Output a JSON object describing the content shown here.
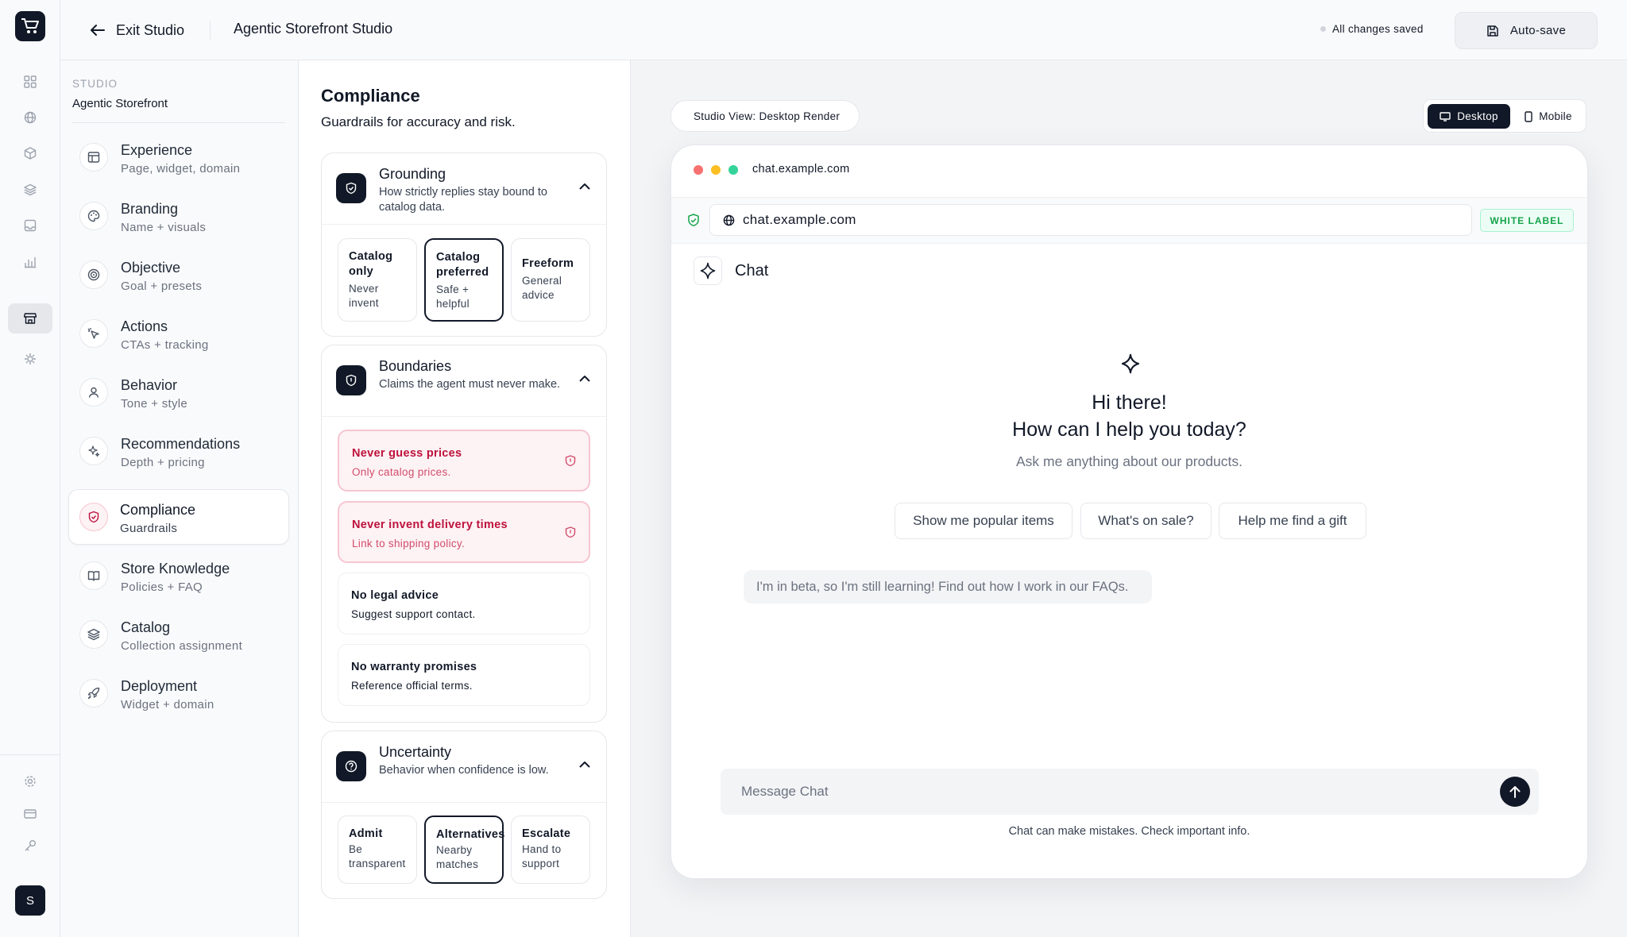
{
  "topbar": {
    "exit_label": "Exit Studio",
    "title": "Agentic Storefront Studio",
    "status": "All changes saved",
    "autosave_label": "Auto-save"
  },
  "rail": {
    "user_initial": "S"
  },
  "sidebar": {
    "section_label": "STUDIO",
    "section_title": "Agentic Storefront",
    "items": [
      {
        "title": "Experience",
        "sub": "Page, widget, domain",
        "icon": "layout-icon"
      },
      {
        "title": "Branding",
        "sub": "Name + visuals",
        "icon": "palette-icon"
      },
      {
        "title": "Objective",
        "sub": "Goal + presets",
        "icon": "target-icon"
      },
      {
        "title": "Actions",
        "sub": "CTAs + tracking",
        "icon": "pointer-icon"
      },
      {
        "title": "Behavior",
        "sub": "Tone + style",
        "icon": "user-icon"
      },
      {
        "title": "Recommendations",
        "sub": "Depth + pricing",
        "icon": "sparkles-icon"
      },
      {
        "title": "Compliance",
        "sub": "Guardrails",
        "icon": "shield-icon"
      },
      {
        "title": "Store Knowledge",
        "sub": "Policies + FAQ",
        "icon": "book-icon"
      },
      {
        "title": "Catalog",
        "sub": "Collection assignment",
        "icon": "layers-icon"
      },
      {
        "title": "Deployment",
        "sub": "Widget + domain",
        "icon": "rocket-icon"
      }
    ],
    "active_index": 6
  },
  "compliance": {
    "title": "Compliance",
    "subtitle": "Guardrails for accuracy and risk.",
    "grounding": {
      "title": "Grounding",
      "sub": "How strictly replies stay bound to catalog data.",
      "options": [
        {
          "title": "Catalog only",
          "sub": "Never invent"
        },
        {
          "title": "Catalog preferred",
          "sub": "Safe + helpful"
        },
        {
          "title": "Freeform",
          "sub": "General advice"
        }
      ],
      "selected": 1
    },
    "boundaries": {
      "title": "Boundaries",
      "sub": "Claims the agent must never make.",
      "rules": [
        {
          "title": "Never guess prices",
          "sub": "Only catalog prices.",
          "active": true
        },
        {
          "title": "Never invent delivery times",
          "sub": "Link to shipping policy.",
          "active": true
        },
        {
          "title": "No legal advice",
          "sub": "Suggest support contact.",
          "active": false
        },
        {
          "title": "No warranty promises",
          "sub": "Reference official terms.",
          "active": false
        }
      ]
    },
    "uncertainty": {
      "title": "Uncertainty",
      "sub": "Behavior when confidence is low.",
      "options": [
        {
          "title": "Admit",
          "sub": "Be transparent"
        },
        {
          "title": "Alternatives",
          "sub": "Nearby matches"
        },
        {
          "title": "Escalate",
          "sub": "Hand to support"
        }
      ],
      "selected": 1
    }
  },
  "preview": {
    "view_label": "Studio View: Desktop Render",
    "desktop_label": "Desktop",
    "mobile_label": "Mobile",
    "window_domain": "chat.example.com",
    "url": "chat.example.com",
    "badge": "WHITE LABEL",
    "chat_title": "Chat",
    "greeting_1": "Hi there!",
    "greeting_2": "How can I help you today?",
    "greeting_sub": "Ask me anything about our products.",
    "suggestions": [
      "Show me popular items",
      "What's on sale?",
      "Help me find a gift"
    ],
    "beta_note": "I'm in beta, so I'm still learning! Find out how I work in our FAQs.",
    "input_placeholder": "Message Chat",
    "disclaimer": "Chat can make mistakes. Check important info."
  },
  "colors": {
    "accent_dark": "#111827",
    "warn_red": "#be123c",
    "badge_green": "#16a34a"
  }
}
